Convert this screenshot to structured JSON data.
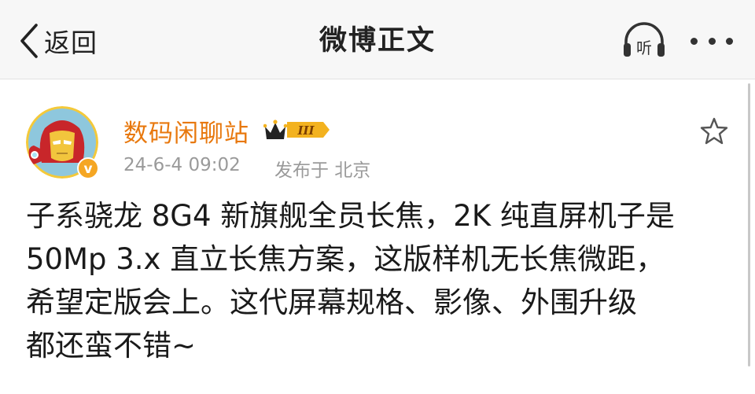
{
  "navbar": {
    "back_label": "返回",
    "title": "微博正文",
    "listen_label": "听",
    "icons": {
      "back": "chevron-left-icon",
      "listen": "headphones-icon",
      "more": "more-dots-icon"
    }
  },
  "post": {
    "author": {
      "name": "数码闲聊站",
      "level_badge": "III",
      "verified": true,
      "verified_mark": "v"
    },
    "timestamp": "24-6-4 09:02",
    "location": "发布于 北京",
    "text_lines": [
      "子系骁龙 8G4 新旗舰全员长焦，2K 纯直屏机子是",
      "50Mp 3.x 直立长焦方案，这版样机无长焦微距，",
      "希望定版会上。这代屏幕规格、影像、外围升级",
      "都还蛮不错~"
    ],
    "favorite_icon": "star-outline-icon"
  },
  "colors": {
    "username": "#e8780d",
    "meta": "#9a9a9a",
    "navbar_bg": "#f7f7f7",
    "verified_badge": "#f5a623",
    "level_badge": "#f3b21f"
  }
}
